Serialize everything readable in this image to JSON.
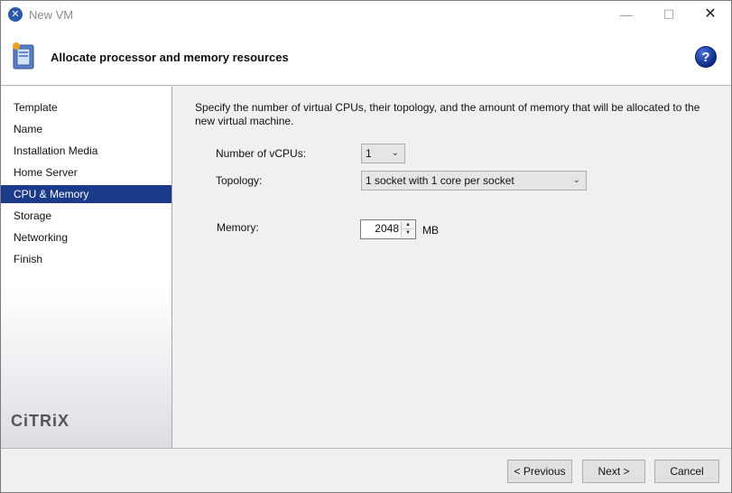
{
  "window": {
    "title": "New VM"
  },
  "header": {
    "title": "Allocate processor and memory resources",
    "help_glyph": "?"
  },
  "sidebar": {
    "items": [
      {
        "label": "Template"
      },
      {
        "label": "Name"
      },
      {
        "label": "Installation Media"
      },
      {
        "label": "Home Server"
      },
      {
        "label": "CPU & Memory",
        "active": true
      },
      {
        "label": "Storage"
      },
      {
        "label": "Networking"
      },
      {
        "label": "Finish"
      }
    ],
    "brand": "CiTRiX"
  },
  "main": {
    "description": "Specify the number of virtual CPUs, their topology, and the amount of memory that will be allocated to the new virtual machine.",
    "vcpus": {
      "label": "Number of vCPUs:",
      "value": "1"
    },
    "topology": {
      "label": "Topology:",
      "value": "1 socket with 1 core per socket"
    },
    "memory": {
      "label": "Memory:",
      "value": "2048",
      "unit": "MB"
    }
  },
  "footer": {
    "previous_label": "< Previous",
    "next_label": "Next >",
    "cancel_label": "Cancel"
  },
  "colors": {
    "accent": "#1c3a8a",
    "help": "#0d2a8c"
  },
  "icons": [
    "app-icon",
    "wizard-icon",
    "help-icon",
    "dropdown-arrow-icon",
    "spin-up-icon",
    "spin-down-icon",
    "close-icon",
    "minimize-icon",
    "maximize-icon"
  ]
}
